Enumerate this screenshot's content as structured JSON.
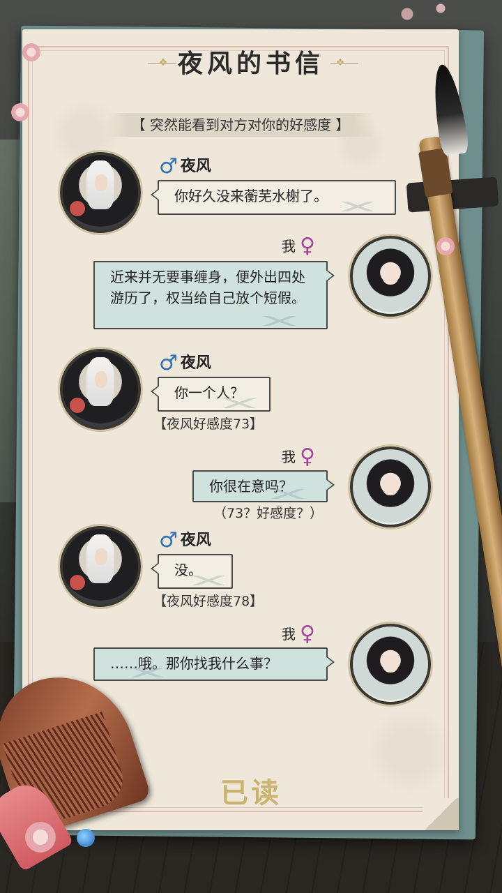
{
  "letter": {
    "title": "夜风的书信",
    "subtitle": "【 突然能看到对方对你的好感度 】",
    "read_status": "已读"
  },
  "colors": {
    "male_symbol": "#2d6fb3",
    "female_symbol": "#a4459c",
    "incoming_bubble": "#f3eee3",
    "outgoing_bubble": "#cfe2de",
    "read_stamp": "#c9b36e"
  },
  "symbols": {
    "male": "♂",
    "female": "♀"
  },
  "messages": [
    {
      "sender": "夜风",
      "side": "left",
      "text": "你好久没来蘅芜水榭了。",
      "note": ""
    },
    {
      "sender": "我",
      "side": "right",
      "text": "近来并无要事缠身，便外出四处游历了，权当给自己放个短假。",
      "note": ""
    },
    {
      "sender": "夜风",
      "side": "left",
      "text": "你一个人？",
      "note": "【夜风好感度73】"
    },
    {
      "sender": "我",
      "side": "right",
      "text": "你很在意吗？",
      "note": "（73？好感度？）"
    },
    {
      "sender": "夜风",
      "side": "left",
      "text": "没。",
      "note": "【夜风好感度78】"
    },
    {
      "sender": "我",
      "side": "right",
      "text": "……哦。那你找我什么事？",
      "note": ""
    }
  ]
}
